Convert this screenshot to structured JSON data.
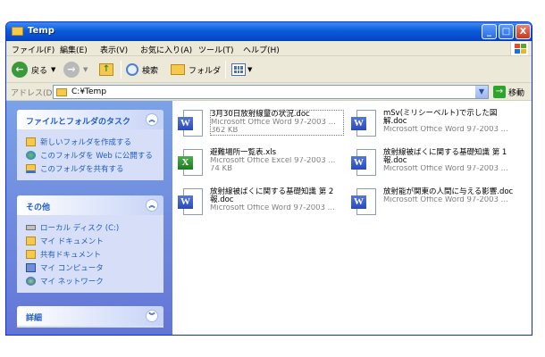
{
  "window": {
    "title": "Temp",
    "minimize": "_",
    "maximize": "□",
    "close": "X"
  },
  "menu": [
    "ファイル(F)",
    "編集(E)",
    "表示(V)",
    "お気に入り(A)",
    "ツール(T)",
    "ヘルプ(H)"
  ],
  "toolbar": {
    "back_label": "戻る",
    "search_label": "検索",
    "folders_label": "フォルダ"
  },
  "address": {
    "label": "アドレス(D)",
    "value": "C:¥Temp",
    "go_label": "移動"
  },
  "tasks_panel": {
    "title": "ファイルとフォルダのタスク",
    "items": [
      {
        "label": "新しいフォルダを作成する",
        "icon": "new-folder-icon"
      },
      {
        "label": "このフォルダを Web に公開する",
        "icon": "globe-icon"
      },
      {
        "label": "このフォルダを共有する",
        "icon": "share-icon"
      }
    ]
  },
  "places_panel": {
    "title": "その他",
    "items": [
      {
        "label": "ローカル ディスク (C:)",
        "icon": "disk-icon"
      },
      {
        "label": "マイ ドキュメント",
        "icon": "my-documents-icon"
      },
      {
        "label": "共有ドキュメント",
        "icon": "shared-folder-icon"
      },
      {
        "label": "マイ コンピュータ",
        "icon": "computer-icon"
      },
      {
        "label": "マイ ネットワーク",
        "icon": "network-icon"
      }
    ]
  },
  "details_panel": {
    "title": "詳細"
  },
  "files": [
    {
      "name": "3月30日放射線量の状況.doc",
      "type": "Microsoft Office Word 97-2003 ...",
      "size": "362 KB",
      "kind": "word"
    },
    {
      "name": "mSv(ミリシーベルト)で示した図解.doc",
      "type": "Microsoft Office Word 97-2003 ...",
      "size": "",
      "kind": "word"
    },
    {
      "name": "避難場所一覧表.xls",
      "type": "Microsoft Office Excel 97-2003 ...",
      "size": "74 KB",
      "kind": "excel"
    },
    {
      "name": "放射線被ばくに関する基礎知識 第 1 報.doc",
      "type": "Microsoft Office Word 97-2003 ...",
      "size": "",
      "kind": "word"
    },
    {
      "name": "放射線被ばくに関する基礎知識 第 2 報.doc",
      "type": "Microsoft Office Word 97-2003 ...",
      "size": "",
      "kind": "word"
    },
    {
      "name": "放射能が関東の人間に与える影響.doc",
      "type": "Microsoft Office Word 97-2003 ...",
      "size": "",
      "kind": "word"
    }
  ],
  "colors": {
    "title_bar": "#0a5cd9",
    "task_link": "#215dc6",
    "word": "#2a4ab8",
    "excel": "#1d7a1d"
  }
}
